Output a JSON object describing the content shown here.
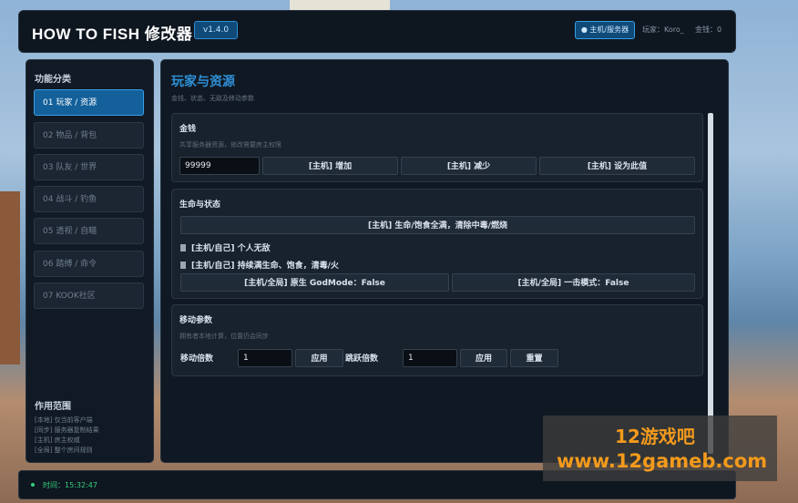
{
  "header": {
    "app_title": "HOW TO FISH  修改器",
    "version": "v1.4.0",
    "host_badge": "● 主机/服务器",
    "player": "玩家：Koro_",
    "money": "金钱：0"
  },
  "sidebar": {
    "heading": "功能分类",
    "items": [
      {
        "label": "01   玩家 / 资源"
      },
      {
        "label": "02   物品 / 背包"
      },
      {
        "label": "03   队友 / 世界"
      },
      {
        "label": "04   战斗 / 钓鱼"
      },
      {
        "label": "05   透视 / 自瞄"
      },
      {
        "label": "06   踏缚 / 命令"
      },
      {
        "label": "07   KOOK社区"
      }
    ],
    "scope_title": "作用范围",
    "scope_lines": [
      "[本地] 仅当前客户端",
      "[同步] 服务器复制结果",
      "[主机] 房主权威",
      "[全局] 整个房间规则"
    ]
  },
  "main": {
    "title": "玩家与资源",
    "subtitle": "金钱、状态、无敌及移动参数",
    "money_card": {
      "title": "金钱",
      "subtitle": "共享服务器资源，修改需要房主权限",
      "input_value": "99999",
      "btn_add": "[主机] 增加",
      "btn_sub": "[主机] 减少",
      "btn_set": "[主机] 设为此值"
    },
    "life_card": {
      "title": "生命与状态",
      "btn_full": "[主机] 生命/饱食全满，清除中毒/燃烧",
      "check_god": "[主机/自己] 个人无敌",
      "check_keep": "[主机/自己] 持续满生命、饱食，清毒/火",
      "btn_godmode": "[主机/全局] 原生 GodMode：False",
      "btn_onehit": "[主机/全局] 一击模式：False"
    },
    "move_card": {
      "title": "移动参数",
      "subtitle": "拥有者本地计算，位置仍会同步",
      "move_label": "移动倍数",
      "move_value": "1",
      "apply_1": "应用",
      "jump_label": "跳跃倍数",
      "jump_value": "1",
      "apply_2": "应用",
      "reset": "重置"
    }
  },
  "status": {
    "time": "时间：15:32:47"
  },
  "watermark": {
    "line1": "12游戏吧",
    "line2": "www.12gameb.com"
  }
}
